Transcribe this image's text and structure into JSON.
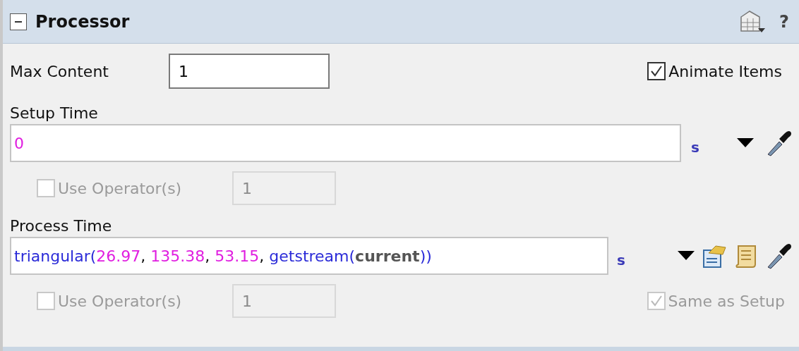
{
  "panel": {
    "title": "Processor",
    "expanded": true,
    "help": "?"
  },
  "max_content": {
    "label": "Max Content",
    "value": "1"
  },
  "animate_items": {
    "label": "Animate Items",
    "checked": true,
    "disabled": false
  },
  "setup_time": {
    "label": "Setup Time",
    "unit": "s",
    "tokens": [
      {
        "text": "0",
        "kind": "number"
      }
    ],
    "use_operators": {
      "label": "Use Operator(s)",
      "checked": false,
      "value": "1",
      "disabled": true
    }
  },
  "process_time": {
    "label": "Process Time",
    "unit": "s",
    "tokens": [
      {
        "text": "triangular(",
        "kind": "function"
      },
      {
        "text": "26.97",
        "kind": "number"
      },
      {
        "text": ", ",
        "kind": "punct"
      },
      {
        "text": "135.38",
        "kind": "number"
      },
      {
        "text": ", ",
        "kind": "punct"
      },
      {
        "text": "53.15",
        "kind": "number"
      },
      {
        "text": ", ",
        "kind": "punct"
      },
      {
        "text": "getstream(",
        "kind": "function"
      },
      {
        "text": "current",
        "kind": "keyword"
      },
      {
        "text": "))",
        "kind": "function"
      }
    ],
    "use_operators": {
      "label": "Use Operator(s)",
      "checked": false,
      "value": "1",
      "disabled": true
    },
    "same_as_setup": {
      "label": "Same as Setup",
      "checked": true,
      "disabled": true
    }
  }
}
